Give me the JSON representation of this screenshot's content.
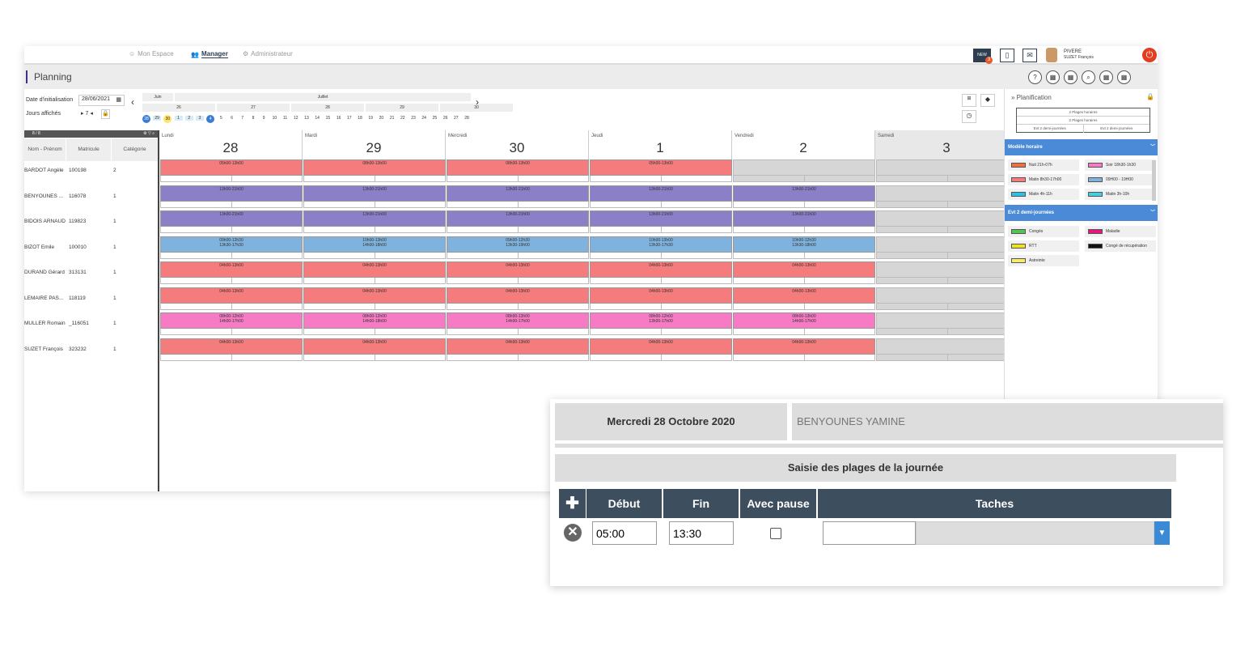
{
  "nav": {
    "mon_espace": "Mon Espace",
    "manager": "Manager",
    "administrateur": "Administrateur"
  },
  "user": {
    "line1": "PIVERE",
    "line2": "SUZET François",
    "badge": "3",
    "new_label": "NEW"
  },
  "page": {
    "title": "Planning"
  },
  "toolbar_icons": [
    "help-icon",
    "calendar-add-icon",
    "calendar-edit-icon",
    "search-icon",
    "calendar-export-icon",
    "calendar-view-icon"
  ],
  "controls": {
    "date_label": "Date d'initialisation",
    "date_value": "28/06/2021",
    "jours_label": "Jours affichés",
    "jours_value": "7"
  },
  "minical": {
    "months": [
      "Juin",
      "Juillet"
    ],
    "weeks": [
      "26",
      "27",
      "28",
      "29",
      "30"
    ],
    "days": [
      "28",
      "29",
      "30",
      "1",
      "2",
      "3",
      "4",
      "5",
      "6",
      "7",
      "8",
      "9",
      "10",
      "11",
      "12",
      "13",
      "14",
      "15",
      "16",
      "17",
      "18",
      "19",
      "20",
      "21",
      "22",
      "23",
      "24",
      "25",
      "26",
      "27",
      "28"
    ]
  },
  "left": {
    "counter": "8 / 8",
    "headers": [
      "Nom - Prénom",
      "Matricule",
      "Catégorie"
    ],
    "employees": [
      {
        "name": "BARDOT Angèle",
        "mat": "100198",
        "cat": "2"
      },
      {
        "name": "BENYOUNES ...",
        "mat": "116078",
        "cat": "1"
      },
      {
        "name": "BIDOIS ARNAUD",
        "mat": "119823",
        "cat": "1"
      },
      {
        "name": "BIZOT Emile",
        "mat": "100010",
        "cat": "1"
      },
      {
        "name": "DURAND Gérard",
        "mat": "313131",
        "cat": "1"
      },
      {
        "name": "LEMAIRE PAS...",
        "mat": "118119",
        "cat": "1"
      },
      {
        "name": "MULLER Romain",
        "mat": "_116051",
        "cat": "1"
      },
      {
        "name": "SUZET François",
        "mat": "323232",
        "cat": "1"
      }
    ]
  },
  "days": [
    {
      "name": "Lundi",
      "num": "28"
    },
    {
      "name": "Mardi",
      "num": "29"
    },
    {
      "name": "Mercredi",
      "num": "30"
    },
    {
      "name": "Jeudi",
      "num": "1"
    },
    {
      "name": "Vendredi",
      "num": "2"
    },
    {
      "name": "Samedi",
      "num": "3"
    }
  ],
  "rows": [
    {
      "color": "#f47c7c",
      "cells": [
        "05h00-13h00",
        "08h00-13h00",
        "08h00-13h00",
        "05h00-13h00"
      ]
    },
    {
      "color": "#8b7fc7",
      "cells": [
        "13h00-21h00",
        "13h00-21h00",
        "13h00-21h00",
        "13h00-21h00",
        "13h00-21h00"
      ]
    },
    {
      "color": "#8b7fc7",
      "cells": [
        "13h00-21h00",
        "13h00-21h00",
        "13h00-21h00",
        "13h00-21h00",
        "13h00-21h00"
      ]
    },
    {
      "color": "#7fb2dd",
      "cells": [
        "09h00-12h30\n13h30-17h30",
        "10h00-13h00\n14h00-18h00",
        "09h00-12h30\n13h30-19h00",
        "10h00-13h00\n13h30-17h30",
        "10h00-12h30\n13h30-18h00"
      ]
    },
    {
      "color": "#f47c7c",
      "cells": [
        "04h00-13h00",
        "04h00-13h00",
        "04h00-13h00",
        "04h00-13h00",
        "04h00-13h00"
      ]
    },
    {
      "color": "#f47c7c",
      "cells": [
        "04h00-13h00",
        "04h00-13h00",
        "04h00-13h00",
        "04h00-13h00",
        "04h00-13h00"
      ]
    },
    {
      "color": "#f77bc4",
      "cells": [
        "08h00-12h00\n14h00-17h00",
        "08h00-12h00\n14h00-18h00",
        "08h00-13h00\n14h00-17h00",
        "08h00-12h00\n13h00-17h00",
        "08h00-13h00\n14h00-17h00"
      ]
    },
    {
      "color": "#f47c7c",
      "cells": [
        "04h00-13h00",
        "04h00-13h00",
        "04h00-13h00",
        "04h00-13h00",
        "04h00-13h00"
      ]
    }
  ],
  "side": {
    "title": "Planification",
    "plan_lines": [
      "2 Plages horaires",
      "2 Plages horaires"
    ],
    "plan_cells": [
      "Evt 2 demi-journées",
      "Evt 2 demi-journées"
    ],
    "modele_title": "Modèle horaire",
    "modele": [
      {
        "label": "Nuit 21h-07h",
        "color": "#f07040"
      },
      {
        "label": "Soir 18h30-1h30",
        "color": "#f77bc4"
      },
      {
        "label": "Matin 8h30-17h00",
        "color": "#f47c7c"
      },
      {
        "label": "09H00 - 19H00",
        "color": "#7fb2dd"
      },
      {
        "label": "Matin 4h-11h",
        "color": "#29c0ea"
      },
      {
        "label": "Matin 3h-10h",
        "color": "#40d0e0"
      }
    ],
    "evt_title": "Evt 2 demi-journées",
    "evt": [
      {
        "label": "Congés",
        "color": "#55c455"
      },
      {
        "label": "Maladie",
        "color": "#e8157d"
      },
      {
        "label": "RTT",
        "color": "#f0e020"
      },
      {
        "label": "Congé de récupération",
        "color": "#111111"
      },
      {
        "label": "Astreinte",
        "color": "#f4ec6a"
      }
    ]
  },
  "dialog": {
    "date": "Mercredi 28 Octobre 2020",
    "employee": "BENYOUNES YAMINE",
    "section": "Saisie des plages de la journée",
    "cols": {
      "debut": "Début",
      "fin": "Fin",
      "pause": "Avec pause",
      "taches": "Taches"
    },
    "row": {
      "debut": "05:00",
      "fin": "13:30",
      "pause": false,
      "taches": ""
    }
  }
}
